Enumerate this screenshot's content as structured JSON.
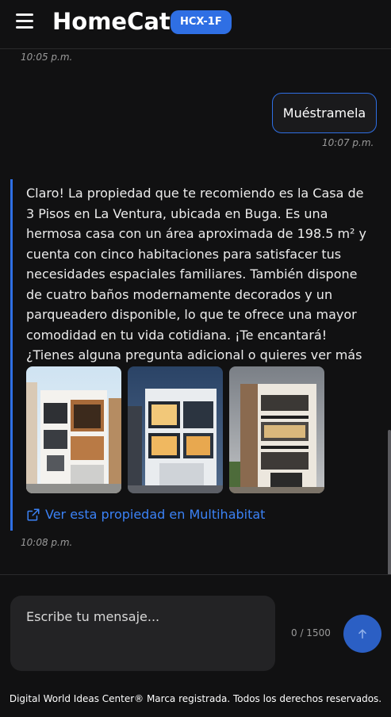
{
  "header": {
    "brand": "HomeCat",
    "badge": "HCX-1F",
    "menu_icon": "hamburger-menu-icon"
  },
  "chat": {
    "messages": [
      {
        "role": "bot",
        "time": "10:05 p.m."
      },
      {
        "role": "user",
        "text": "Muéstramela",
        "time": "10:07 p.m."
      },
      {
        "role": "bot",
        "text": "Claro! La propiedad que te recomiendo es la Casa de 3 Pisos en La Ventura, ubicada en Buga. Es una hermosa casa con un área aproximada de 198.5 m² y cuenta con cinco habitaciones para satisfacer tus necesidades espaciales familiares. También dispone de cuatro baños modernamente decorados y un parqueadero disponible, lo que te ofrece una mayor comodidad en tu vida cotidiana. ¡Te encantará! ¿Tienes alguna pregunta adicional o quieres ver más detalles?",
        "photos": [
          "property-photo-1",
          "property-photo-2",
          "property-photo-3"
        ],
        "link_text": "Ver esta propiedad en Multihabitat",
        "link_icon": "external-link-icon",
        "time": "10:08 p.m."
      }
    ]
  },
  "composer": {
    "placeholder": "Escribe tu mensaje...",
    "counter": "0 / 1500",
    "send_icon": "arrow-up-icon"
  },
  "footer": {
    "text": "Digital World Ideas Center® Marca registrada. Todos los derechos reservados."
  },
  "colors": {
    "accent": "#2f6fe4",
    "background": "#111112",
    "link": "#3b82f6"
  }
}
